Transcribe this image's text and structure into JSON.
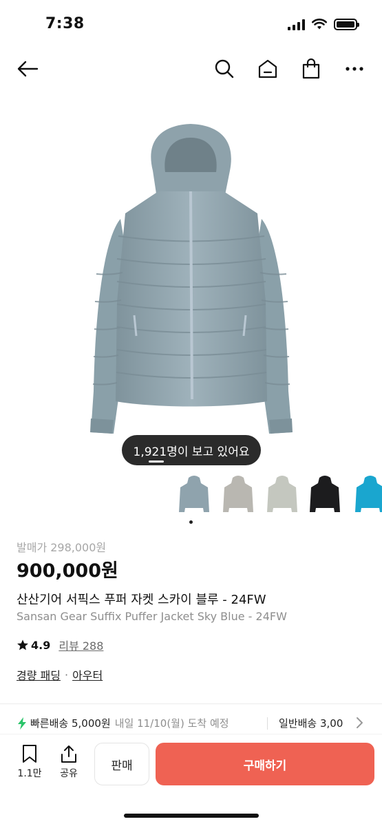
{
  "status_bar": {
    "time": "7:38"
  },
  "nav": {
    "icons": [
      "back-arrow-icon",
      "search-icon",
      "home-icon",
      "shopping-bag-icon",
      "more-icon"
    ]
  },
  "hero": {
    "product_image": "sky-blue-puffer-jacket",
    "viewers_text": "1,921명이 보고 있어요"
  },
  "thumbnails": [
    {
      "color": "#8fa3ad",
      "name": "sky-blue"
    },
    {
      "color": "#b9b7b1",
      "name": "gray-beige"
    },
    {
      "color": "#c4c7bf",
      "name": "light-sage"
    },
    {
      "color": "#1c1c1e",
      "name": "black"
    },
    {
      "color": "#1aa6cf",
      "name": "bright-blue"
    }
  ],
  "product": {
    "original_price": "발매가 298,000원",
    "price": "900,000원",
    "title_ko": "산산기어 서픽스 푸퍼 자켓 스카이 블루 - 24FW",
    "title_en": "Sansan Gear Suffix Puffer Jacket Sky Blue - 24FW",
    "rating": "4.9",
    "reviews": "리뷰 288",
    "category_1": "경량 패딩",
    "category_sep": "·",
    "category_2": "아우터"
  },
  "shipping": {
    "fast_label": "빠른배송 5,000원",
    "fast_eta": "내일 11/10(월) 도착 예정",
    "normal_label": "일반배송 3,00"
  },
  "bottom_bar": {
    "wishlist_count": "1.1만",
    "share_label": "공유",
    "sell_label": "판매",
    "buy_label": "구매하기"
  },
  "colors": {
    "accent": "#ef6253",
    "fast_ship_icon": "#2bc46a"
  }
}
